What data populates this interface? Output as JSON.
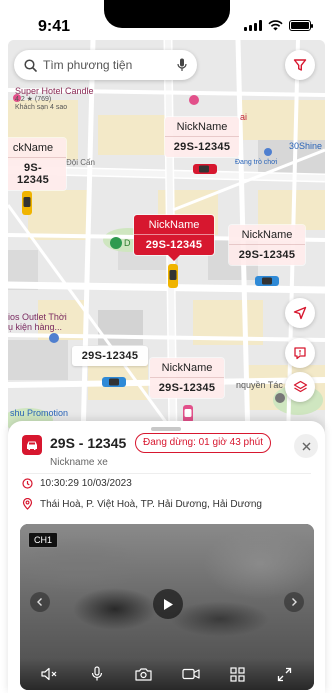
{
  "status_bar": {
    "time": "9:41"
  },
  "search": {
    "placeholder": "Tìm phương tiện"
  },
  "map": {
    "pois": {
      "hotel_name": "Super Hotel Candle",
      "hotel_rating": "4.2 ★ (769)",
      "hotel_type": "Khách sạn 4 sao",
      "road": "Đội Cấn",
      "place_d": "D",
      "outlet_1": "ios Outlet Thời",
      "outlet_2": "ụ kiện hàng...",
      "shine": "30Shine",
      "store": "Đang trò chơi",
      "tax": "nquyền Tác g",
      "promo": "shu Promotion",
      "hai": "ai"
    },
    "vehicles": [
      {
        "nickname": "NickName",
        "plate": "29S-12345"
      },
      {
        "nickname": "ckName",
        "plate": "9S-12345"
      },
      {
        "nickname": "NickName",
        "plate": "29S-12345"
      },
      {
        "nickname": "NickName",
        "plate": "29S-12345"
      },
      {
        "plate": "29S-12345"
      },
      {
        "nickname": "NickName",
        "plate": "29S-12345"
      }
    ]
  },
  "detail": {
    "plate": "29S - 12345",
    "status": "Đang dừng: 01 giờ 43 phút",
    "nickname": "Nickname xe",
    "time": "10:30:29 10/03/2023",
    "address": "Thái Hoà, P. Việt Hoà, TP. Hải Dương, Hải Dương"
  },
  "video": {
    "channel": "CH1"
  },
  "colors": {
    "brand_red": "#d7172f",
    "car_blue": "#2f8ad7",
    "car_yellow": "#f0b400",
    "car_red": "#d7172f"
  }
}
